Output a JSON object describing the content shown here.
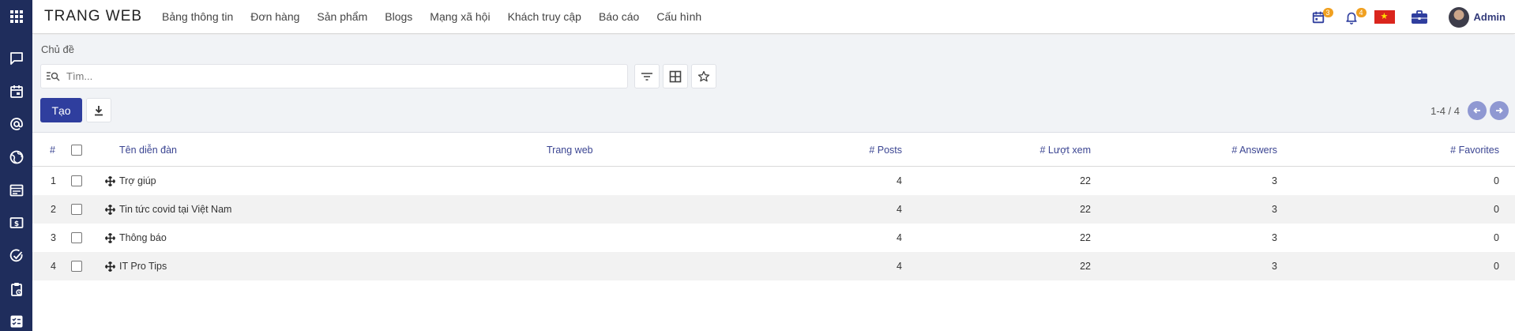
{
  "app": {
    "brand": "TRANG WEB"
  },
  "menu": [
    "Bảng thông tin",
    "Đơn hàng",
    "Sản phẩm",
    "Blogs",
    "Mạng xã hội",
    "Khách truy cập",
    "Báo cáo",
    "Cấu hình"
  ],
  "topbar": {
    "activity_badge": "3",
    "notification_badge": "4",
    "user": "Admin"
  },
  "rail_icons": [
    "chat-icon",
    "calendar-icon",
    "at-icon",
    "globe-icon",
    "browser-icon",
    "invoice-icon",
    "check-circle-icon",
    "clipboard-icon",
    "checklist-icon"
  ],
  "control": {
    "breadcrumb": "Chủ đề",
    "search_placeholder": "Tìm...",
    "create_label": "Tạo",
    "pager": "1-4 / 4"
  },
  "table": {
    "headers": {
      "index": "#",
      "name": "Tên diễn đàn",
      "website": "Trang web",
      "posts": "# Posts",
      "views": "# Lượt xem",
      "answers": "# Answers",
      "favorites": "# Favorites"
    },
    "rows": [
      {
        "index": "1",
        "name": "Trợ giúp",
        "website": "",
        "posts": "4",
        "views": "22",
        "answers": "3",
        "favorites": "0"
      },
      {
        "index": "2",
        "name": "Tin tức covid tại Việt Nam",
        "website": "",
        "posts": "4",
        "views": "22",
        "answers": "3",
        "favorites": "0"
      },
      {
        "index": "3",
        "name": "Thông báo",
        "website": "",
        "posts": "4",
        "views": "22",
        "answers": "3",
        "favorites": "0"
      },
      {
        "index": "4",
        "name": "IT Pro Tips",
        "website": "",
        "posts": "4",
        "views": "22",
        "answers": "3",
        "favorites": "0"
      }
    ]
  }
}
